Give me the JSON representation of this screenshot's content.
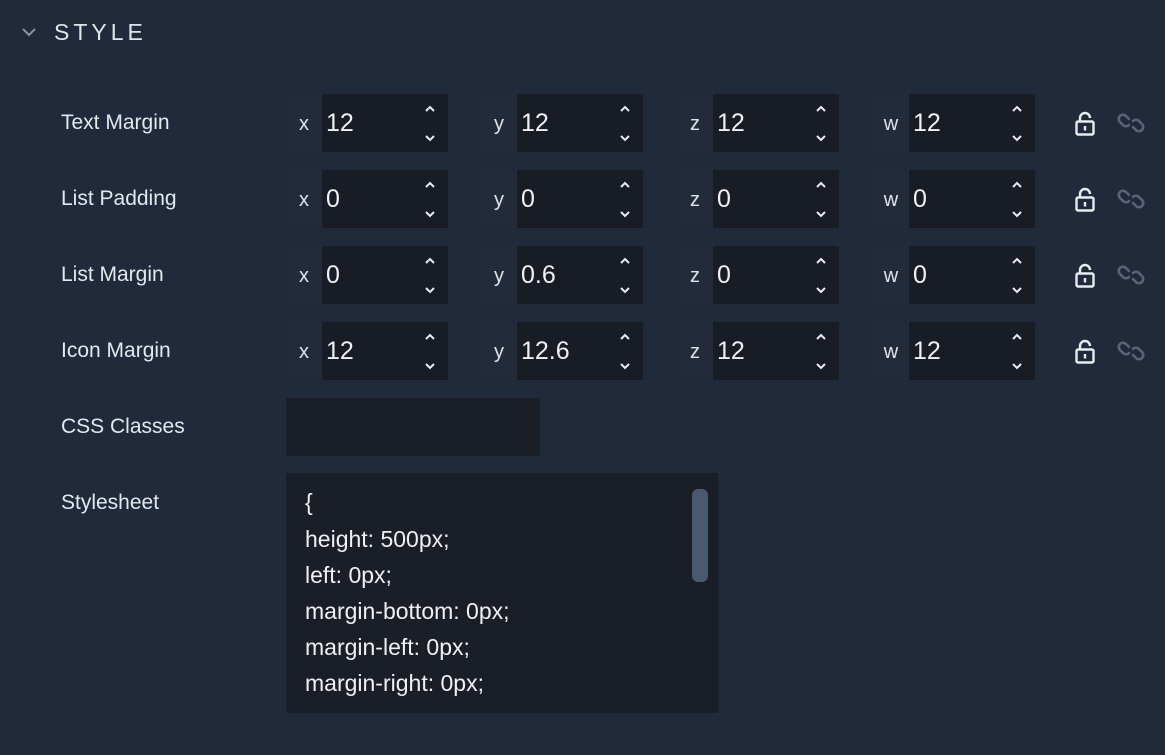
{
  "section": {
    "title": "STYLE",
    "chevron_icon": "chevron-down-icon"
  },
  "rows": [
    {
      "label": "Text Margin",
      "fields": [
        {
          "axis": "x",
          "value": "12"
        },
        {
          "axis": "y",
          "value": "12"
        },
        {
          "axis": "z",
          "value": "12"
        },
        {
          "axis": "w",
          "value": "12"
        }
      ]
    },
    {
      "label": "List Padding",
      "fields": [
        {
          "axis": "x",
          "value": "0"
        },
        {
          "axis": "y",
          "value": "0"
        },
        {
          "axis": "z",
          "value": "0"
        },
        {
          "axis": "w",
          "value": "0"
        }
      ]
    },
    {
      "label": "List Margin",
      "fields": [
        {
          "axis": "x",
          "value": "0"
        },
        {
          "axis": "y",
          "value": "0.6"
        },
        {
          "axis": "z",
          "value": "0"
        },
        {
          "axis": "w",
          "value": "0"
        }
      ]
    },
    {
      "label": "Icon Margin",
      "fields": [
        {
          "axis": "x",
          "value": "12"
        },
        {
          "axis": "y",
          "value": "12.6"
        },
        {
          "axis": "z",
          "value": "12"
        },
        {
          "axis": "w",
          "value": "12"
        }
      ]
    }
  ],
  "css_classes": {
    "label": "CSS Classes",
    "value": ""
  },
  "stylesheet": {
    "label": "Stylesheet",
    "lines": [
      "{",
      "height: 500px;",
      "left: 0px;",
      "margin-bottom: 0px;",
      "margin-left: 0px;",
      "margin-right: 0px;"
    ]
  },
  "icons": {
    "lock": "lock-open-icon",
    "link": "link-icon",
    "step_up": "chevron-up-icon",
    "step_down": "chevron-down-icon"
  },
  "colors": {
    "background": "#212a3a",
    "input_background": "#181c25",
    "axis_background": "#232b3b",
    "text": "#e8ebf0",
    "disabled_icon": "#5a6478"
  }
}
